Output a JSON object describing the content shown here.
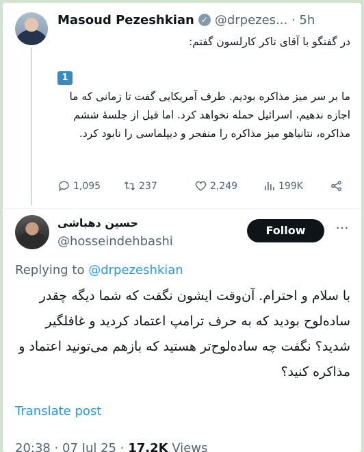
{
  "quoted_tweet": {
    "author_name": "Masoud Pezeshkian",
    "verified_icon": "verified-badge-gray",
    "handle_time": "@drpezes... · 5h",
    "intro": "در گفتگو با آقای تاکر کارلسون گفتم:",
    "number_badge": "1",
    "body": "ما بر سر میز مذاکره بودیم. طرف آمریکایی گفت تا زمانی که ما اجازه ندهیم، اسرائیل حمله نخواهد کرد. اما قبل از جلسهٔ ششم مذاکره، نتانیاهو میز مذاکره را منفجر و دیپلماسی را نابود کرد.",
    "stats": {
      "replies": "1,095",
      "reposts": "237",
      "likes": "2,249",
      "views": "199K"
    }
  },
  "reply_tweet": {
    "author_name": "حسین دهباشی",
    "handle": "@hosseindehbashi",
    "follow_label": "Follow",
    "replying_prefix": "Replying to",
    "replying_to": "@drpezeshkian",
    "body": "با سلام و احترام. آن‌وقت ایشون نگفت که شما دیگه چقدر ساده‌لوح بودید که به حرف ترامپ اعتماد کردید و غافلگیر شدید؟ نگفت چه ساده‌لوح‌تر هستید که بازهم می‌تونید اعتماد و مذاکره کنید؟",
    "translate_label": "Translate post",
    "meta_datetime": "20:38 · 07 Jul 25 · ",
    "meta_views_count": "17.2K",
    "meta_views_label": " Views"
  },
  "colors": {
    "background": "#cfe3cf",
    "text": "#0f1419",
    "muted": "#536471",
    "link": "#1d9bf0",
    "follow_bg": "#0f1419"
  }
}
